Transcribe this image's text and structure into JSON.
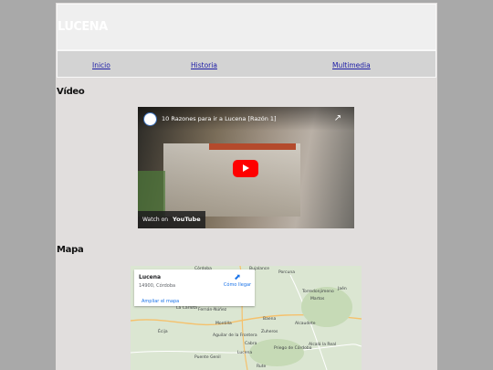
{
  "header": {
    "title": "LUCENA"
  },
  "nav": {
    "items": [
      "Inicio",
      "Historia",
      "Multimedia"
    ]
  },
  "video_section": {
    "heading": "Vídeo",
    "video": {
      "title": "10 Razones para ir a Lucena [Razón 1]",
      "watch_label": "Watch on",
      "yt_label": "YouTube"
    }
  },
  "map_section": {
    "heading": "Mapa",
    "map": {
      "place_name": "Lucena",
      "place_address": "14900, Córdoba",
      "directions_label": "Cómo llegar",
      "enlarge_label": "Ampliar el mapa",
      "places": [
        "Córdoba",
        "Bujalance",
        "Porcuna",
        "Jaén",
        "Torredonjimeno",
        "Martos",
        "Écija",
        "La Carlota",
        "Fernán-Núñez",
        "Montilla",
        "Baena",
        "Alcaudete",
        "Zuheros",
        "Aguilar de la Frontera",
        "Cabra",
        "Priego de Córdoba",
        "Alcalá la Real",
        "Puente Genil",
        "Lucena",
        "Rute"
      ]
    }
  },
  "colors": {
    "page_bg": "#e1dedd",
    "outer_bg": "#a9a9a9",
    "link": "#1a1aa6"
  }
}
